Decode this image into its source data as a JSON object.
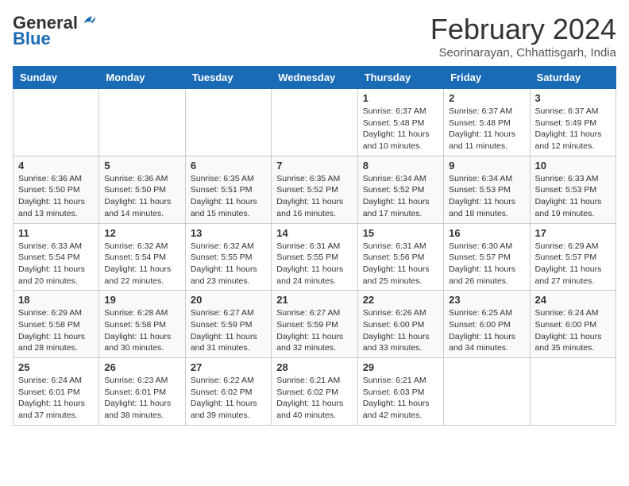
{
  "header": {
    "logo_general": "General",
    "logo_blue": "Blue",
    "month_year": "February 2024",
    "location": "Seorinarayan, Chhattisgarh, India"
  },
  "weekdays": [
    "Sunday",
    "Monday",
    "Tuesday",
    "Wednesday",
    "Thursday",
    "Friday",
    "Saturday"
  ],
  "weeks": [
    [
      {
        "day": "",
        "info": ""
      },
      {
        "day": "",
        "info": ""
      },
      {
        "day": "",
        "info": ""
      },
      {
        "day": "",
        "info": ""
      },
      {
        "day": "1",
        "info": "Sunrise: 6:37 AM\nSunset: 5:48 PM\nDaylight: 11 hours\nand 10 minutes."
      },
      {
        "day": "2",
        "info": "Sunrise: 6:37 AM\nSunset: 5:48 PM\nDaylight: 11 hours\nand 11 minutes."
      },
      {
        "day": "3",
        "info": "Sunrise: 6:37 AM\nSunset: 5:49 PM\nDaylight: 11 hours\nand 12 minutes."
      }
    ],
    [
      {
        "day": "4",
        "info": "Sunrise: 6:36 AM\nSunset: 5:50 PM\nDaylight: 11 hours\nand 13 minutes."
      },
      {
        "day": "5",
        "info": "Sunrise: 6:36 AM\nSunset: 5:50 PM\nDaylight: 11 hours\nand 14 minutes."
      },
      {
        "day": "6",
        "info": "Sunrise: 6:35 AM\nSunset: 5:51 PM\nDaylight: 11 hours\nand 15 minutes."
      },
      {
        "day": "7",
        "info": "Sunrise: 6:35 AM\nSunset: 5:52 PM\nDaylight: 11 hours\nand 16 minutes."
      },
      {
        "day": "8",
        "info": "Sunrise: 6:34 AM\nSunset: 5:52 PM\nDaylight: 11 hours\nand 17 minutes."
      },
      {
        "day": "9",
        "info": "Sunrise: 6:34 AM\nSunset: 5:53 PM\nDaylight: 11 hours\nand 18 minutes."
      },
      {
        "day": "10",
        "info": "Sunrise: 6:33 AM\nSunset: 5:53 PM\nDaylight: 11 hours\nand 19 minutes."
      }
    ],
    [
      {
        "day": "11",
        "info": "Sunrise: 6:33 AM\nSunset: 5:54 PM\nDaylight: 11 hours\nand 20 minutes."
      },
      {
        "day": "12",
        "info": "Sunrise: 6:32 AM\nSunset: 5:54 PM\nDaylight: 11 hours\nand 22 minutes."
      },
      {
        "day": "13",
        "info": "Sunrise: 6:32 AM\nSunset: 5:55 PM\nDaylight: 11 hours\nand 23 minutes."
      },
      {
        "day": "14",
        "info": "Sunrise: 6:31 AM\nSunset: 5:55 PM\nDaylight: 11 hours\nand 24 minutes."
      },
      {
        "day": "15",
        "info": "Sunrise: 6:31 AM\nSunset: 5:56 PM\nDaylight: 11 hours\nand 25 minutes."
      },
      {
        "day": "16",
        "info": "Sunrise: 6:30 AM\nSunset: 5:57 PM\nDaylight: 11 hours\nand 26 minutes."
      },
      {
        "day": "17",
        "info": "Sunrise: 6:29 AM\nSunset: 5:57 PM\nDaylight: 11 hours\nand 27 minutes."
      }
    ],
    [
      {
        "day": "18",
        "info": "Sunrise: 6:29 AM\nSunset: 5:58 PM\nDaylight: 11 hours\nand 28 minutes."
      },
      {
        "day": "19",
        "info": "Sunrise: 6:28 AM\nSunset: 5:58 PM\nDaylight: 11 hours\nand 30 minutes."
      },
      {
        "day": "20",
        "info": "Sunrise: 6:27 AM\nSunset: 5:59 PM\nDaylight: 11 hours\nand 31 minutes."
      },
      {
        "day": "21",
        "info": "Sunrise: 6:27 AM\nSunset: 5:59 PM\nDaylight: 11 hours\nand 32 minutes."
      },
      {
        "day": "22",
        "info": "Sunrise: 6:26 AM\nSunset: 6:00 PM\nDaylight: 11 hours\nand 33 minutes."
      },
      {
        "day": "23",
        "info": "Sunrise: 6:25 AM\nSunset: 6:00 PM\nDaylight: 11 hours\nand 34 minutes."
      },
      {
        "day": "24",
        "info": "Sunrise: 6:24 AM\nSunset: 6:00 PM\nDaylight: 11 hours\nand 35 minutes."
      }
    ],
    [
      {
        "day": "25",
        "info": "Sunrise: 6:24 AM\nSunset: 6:01 PM\nDaylight: 11 hours\nand 37 minutes."
      },
      {
        "day": "26",
        "info": "Sunrise: 6:23 AM\nSunset: 6:01 PM\nDaylight: 11 hours\nand 38 minutes."
      },
      {
        "day": "27",
        "info": "Sunrise: 6:22 AM\nSunset: 6:02 PM\nDaylight: 11 hours\nand 39 minutes."
      },
      {
        "day": "28",
        "info": "Sunrise: 6:21 AM\nSunset: 6:02 PM\nDaylight: 11 hours\nand 40 minutes."
      },
      {
        "day": "29",
        "info": "Sunrise: 6:21 AM\nSunset: 6:03 PM\nDaylight: 11 hours\nand 42 minutes."
      },
      {
        "day": "",
        "info": ""
      },
      {
        "day": "",
        "info": ""
      }
    ]
  ]
}
